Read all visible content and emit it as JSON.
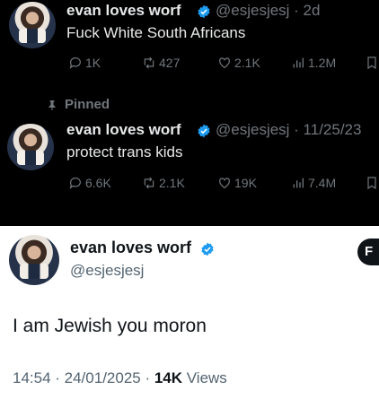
{
  "tweet1": {
    "name": "evan loves worf",
    "handle": "@esjesjesj · 2d",
    "text": "Fuck White South Africans",
    "replies": "1K",
    "retweets": "427",
    "likes": "2.1K",
    "views": "1.2M"
  },
  "pinned_label": "Pinned",
  "tweet2": {
    "name": "evan loves worf",
    "handle": "@esjesjesj · 11/25/23",
    "text": "protect trans kids",
    "replies": "6.6K",
    "retweets": "2.1K",
    "likes": "19K",
    "views": "7.4M"
  },
  "tweet3": {
    "name": "evan loves worf",
    "handle": "@esjesjesj",
    "text": "I am Jewish you moron",
    "time": "14:54 · 24/01/2025 · ",
    "views_count": "14K",
    "views_label": " Views",
    "follow_label": "F"
  },
  "colors": {
    "verified": "#1d9bf0",
    "dark_bg": "#000000",
    "muted": "#71767b"
  }
}
